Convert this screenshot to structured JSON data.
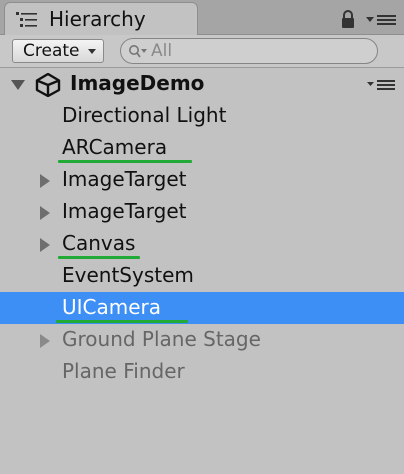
{
  "window": {
    "tab_title": "Hierarchy",
    "tab_icon": "hierarchy-list-icon"
  },
  "toolbar": {
    "create_label": "Create",
    "search_placeholder": "All"
  },
  "scene": {
    "name": "ImageDemo",
    "icon": "unity-logo-icon",
    "expanded": true
  },
  "items": [
    {
      "label": "Directional Light",
      "expandable": false,
      "selected": false,
      "dimmed": false,
      "underlined": false
    },
    {
      "label": "ARCamera",
      "expandable": false,
      "selected": false,
      "dimmed": false,
      "underlined": true
    },
    {
      "label": "ImageTarget",
      "expandable": true,
      "selected": false,
      "dimmed": false,
      "underlined": false
    },
    {
      "label": "ImageTarget",
      "expandable": true,
      "selected": false,
      "dimmed": false,
      "underlined": false
    },
    {
      "label": "Canvas",
      "expandable": true,
      "selected": false,
      "dimmed": false,
      "underlined": true
    },
    {
      "label": "EventSystem",
      "expandable": false,
      "selected": false,
      "dimmed": false,
      "underlined": false
    },
    {
      "label": "UICamera",
      "expandable": false,
      "selected": true,
      "dimmed": false,
      "underlined": true
    },
    {
      "label": "Ground Plane Stage",
      "expandable": true,
      "selected": false,
      "dimmed": true,
      "underlined": false
    },
    {
      "label": "Plane Finder",
      "expandable": false,
      "selected": false,
      "dimmed": true,
      "underlined": false
    }
  ],
  "colors": {
    "selection": "#3d8ef5",
    "annotation_underline": "#22aa36",
    "panel_background": "#c2c2c2"
  }
}
